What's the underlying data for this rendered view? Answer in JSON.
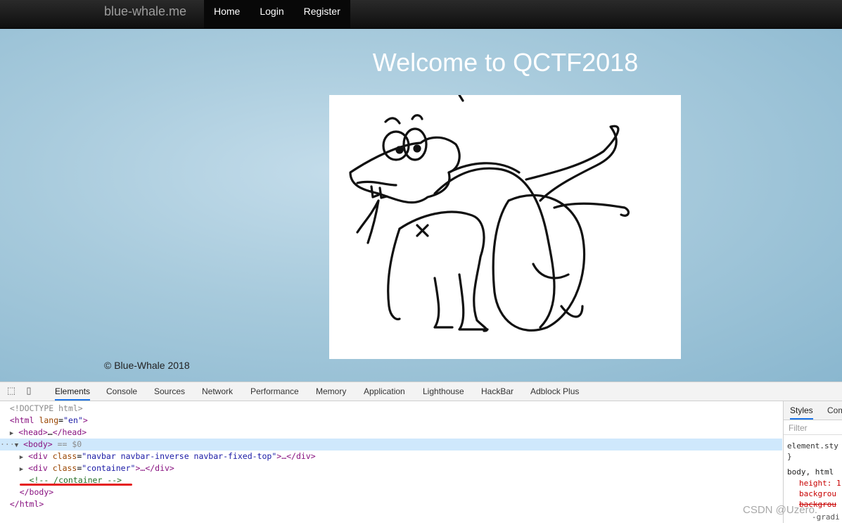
{
  "navbar": {
    "brand": "blue-whale.me",
    "items": [
      {
        "label": "Home"
      },
      {
        "label": "Login"
      },
      {
        "label": "Register"
      }
    ]
  },
  "main": {
    "heading": "Welcome to QCTF2018",
    "footer": "© Blue-Whale 2018"
  },
  "devtools": {
    "tabs": [
      "Elements",
      "Console",
      "Sources",
      "Network",
      "Performance",
      "Memory",
      "Application",
      "Lighthouse",
      "HackBar",
      "Adblock Plus"
    ],
    "active_tab": "Elements",
    "dom": {
      "doctype": "<!DOCTYPE html>",
      "html_tag": "html",
      "html_attr": "lang",
      "html_val": "en",
      "head_open": "<head>",
      "head_ellipsis": "…",
      "head_close": "</head>",
      "body_tag": "<body>",
      "body_marker": " == $0",
      "div1_tag": "div",
      "div1_attr": "class",
      "div1_val": "navbar navbar-inverse navbar-fixed-top",
      "div2_tag": "div",
      "div2_attr": "class",
      "div2_val": "container",
      "ellipsis_close": ">…</div>",
      "comment": "<!-- /container -->",
      "body_close": "</body>",
      "html_close": "</html>"
    },
    "styles": {
      "tabs": [
        "Styles",
        "Com"
      ],
      "filter_placeholder": "Filter",
      "lines": [
        "element.sty",
        "}",
        "body, html",
        "height: 1",
        "backgrou",
        "backgrou",
        "-gradi"
      ]
    }
  },
  "watermark": "CSDN @Uzero."
}
